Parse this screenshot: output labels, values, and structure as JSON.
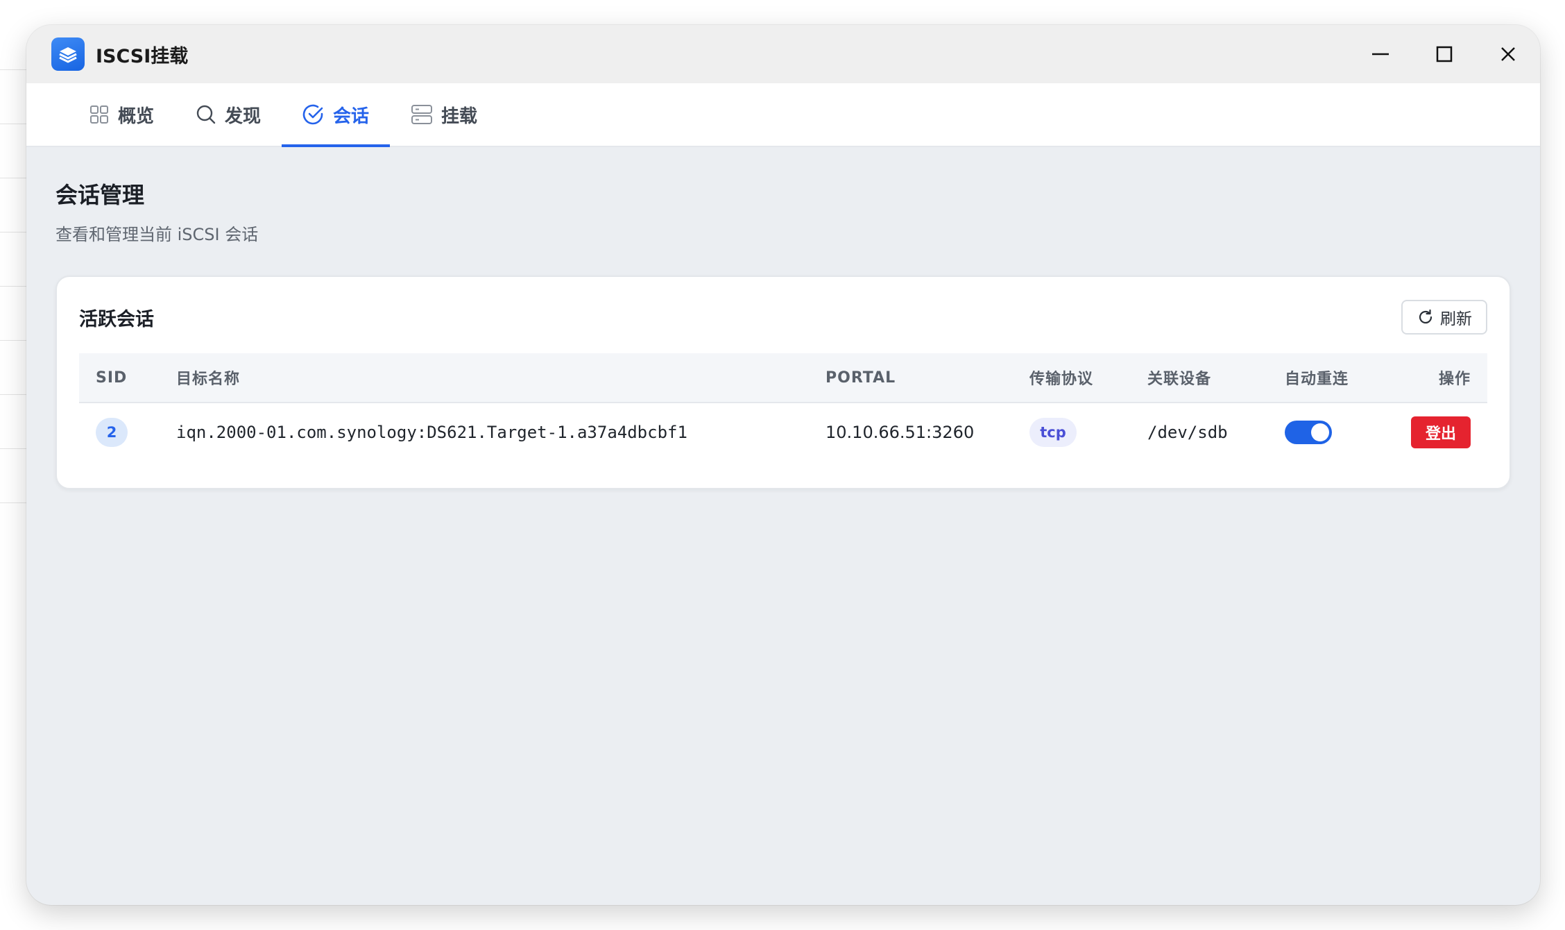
{
  "window": {
    "title": "ISCSI挂载"
  },
  "tabs": [
    {
      "label": "概览",
      "icon": "grid-icon",
      "active": false
    },
    {
      "label": "发现",
      "icon": "search-icon",
      "active": false
    },
    {
      "label": "会话",
      "icon": "check-circle-icon",
      "active": true
    },
    {
      "label": "挂载",
      "icon": "server-icon",
      "active": false
    }
  ],
  "page": {
    "title": "会话管理",
    "subtitle": "查看和管理当前 iSCSI 会话"
  },
  "card": {
    "title": "活跃会话",
    "refresh_label": "刷新"
  },
  "table": {
    "headers": {
      "sid": "SID",
      "target": "目标名称",
      "portal": "PORTAL",
      "transport": "传输协议",
      "device": "关联设备",
      "auto_reconnect": "自动重连",
      "actions": "操作"
    },
    "rows": [
      {
        "sid": "2",
        "target": "iqn.2000-01.com.synology:DS621.Target-1.a37a4dbcbf1",
        "portal": "10.10.66.51:3260",
        "transport": "tcp",
        "device": "/dev/sdb",
        "auto_reconnect": true,
        "action_label": "登出"
      }
    ]
  },
  "colors": {
    "accent": "#2563eb",
    "danger": "#e5232f",
    "page_bg": "#ebeef2"
  }
}
